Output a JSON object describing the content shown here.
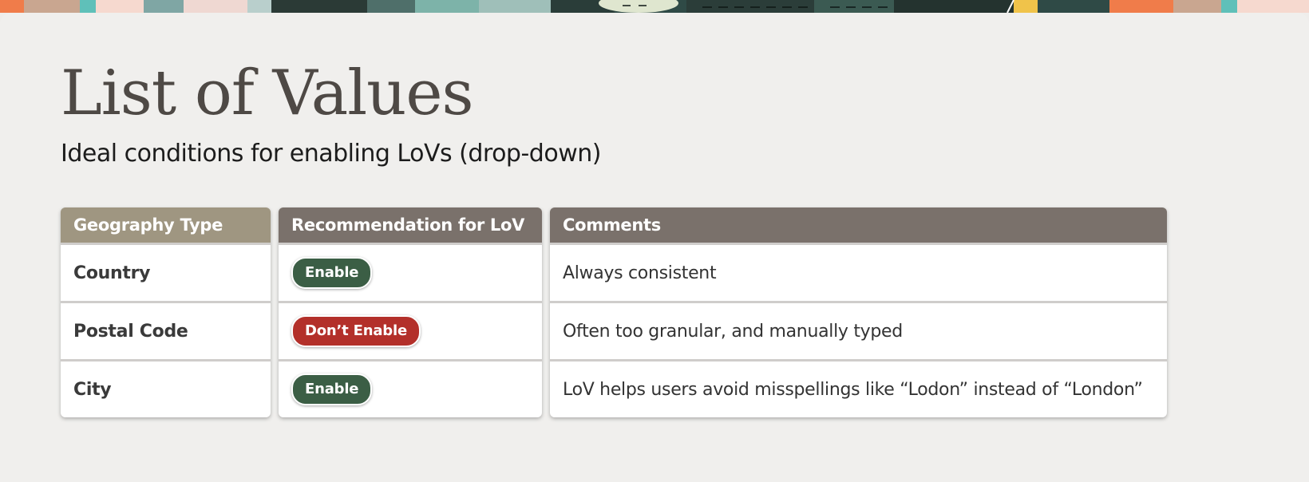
{
  "title": "List of Values",
  "subtitle": "Ideal conditions for enabling LoVs (drop-down)",
  "table": {
    "headers": [
      "Geography Type",
      "Recommendation for LoV",
      "Comments"
    ],
    "rows": [
      {
        "type": "Country",
        "recommendation": "Enable",
        "status": "enable",
        "comment": "Always consistent"
      },
      {
        "type": "Postal Code",
        "recommendation": "Don’t Enable",
        "status": "dont",
        "comment": "Often too granular, and manually typed"
      },
      {
        "type": "City",
        "recommendation": "Enable",
        "status": "enable",
        "comment": "LoV helps users avoid misspellings like “Lodon” instead of “London”"
      }
    ]
  },
  "colors": {
    "enable": "#3b5e45",
    "dont_enable": "#b3302a",
    "header_primary": "#9f9681",
    "header_secondary": "#7a716b"
  }
}
